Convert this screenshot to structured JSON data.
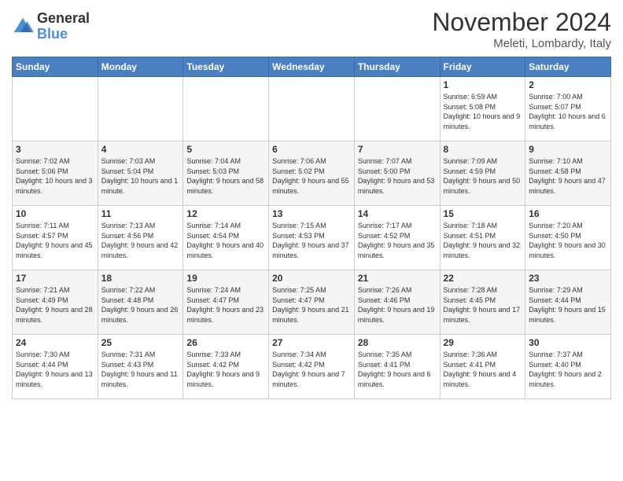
{
  "header": {
    "logo_general": "General",
    "logo_blue": "Blue",
    "month_title": "November 2024",
    "subtitle": "Meleti, Lombardy, Italy"
  },
  "days_of_week": [
    "Sunday",
    "Monday",
    "Tuesday",
    "Wednesday",
    "Thursday",
    "Friday",
    "Saturday"
  ],
  "weeks": [
    [
      {
        "day": "",
        "info": ""
      },
      {
        "day": "",
        "info": ""
      },
      {
        "day": "",
        "info": ""
      },
      {
        "day": "",
        "info": ""
      },
      {
        "day": "",
        "info": ""
      },
      {
        "day": "1",
        "info": "Sunrise: 6:59 AM\nSunset: 5:08 PM\nDaylight: 10 hours and 9 minutes."
      },
      {
        "day": "2",
        "info": "Sunrise: 7:00 AM\nSunset: 5:07 PM\nDaylight: 10 hours and 6 minutes."
      }
    ],
    [
      {
        "day": "3",
        "info": "Sunrise: 7:02 AM\nSunset: 5:06 PM\nDaylight: 10 hours and 3 minutes."
      },
      {
        "day": "4",
        "info": "Sunrise: 7:03 AM\nSunset: 5:04 PM\nDaylight: 10 hours and 1 minute."
      },
      {
        "day": "5",
        "info": "Sunrise: 7:04 AM\nSunset: 5:03 PM\nDaylight: 9 hours and 58 minutes."
      },
      {
        "day": "6",
        "info": "Sunrise: 7:06 AM\nSunset: 5:02 PM\nDaylight: 9 hours and 55 minutes."
      },
      {
        "day": "7",
        "info": "Sunrise: 7:07 AM\nSunset: 5:00 PM\nDaylight: 9 hours and 53 minutes."
      },
      {
        "day": "8",
        "info": "Sunrise: 7:09 AM\nSunset: 4:59 PM\nDaylight: 9 hours and 50 minutes."
      },
      {
        "day": "9",
        "info": "Sunrise: 7:10 AM\nSunset: 4:58 PM\nDaylight: 9 hours and 47 minutes."
      }
    ],
    [
      {
        "day": "10",
        "info": "Sunrise: 7:11 AM\nSunset: 4:57 PM\nDaylight: 9 hours and 45 minutes."
      },
      {
        "day": "11",
        "info": "Sunrise: 7:13 AM\nSunset: 4:56 PM\nDaylight: 9 hours and 42 minutes."
      },
      {
        "day": "12",
        "info": "Sunrise: 7:14 AM\nSunset: 4:54 PM\nDaylight: 9 hours and 40 minutes."
      },
      {
        "day": "13",
        "info": "Sunrise: 7:15 AM\nSunset: 4:53 PM\nDaylight: 9 hours and 37 minutes."
      },
      {
        "day": "14",
        "info": "Sunrise: 7:17 AM\nSunset: 4:52 PM\nDaylight: 9 hours and 35 minutes."
      },
      {
        "day": "15",
        "info": "Sunrise: 7:18 AM\nSunset: 4:51 PM\nDaylight: 9 hours and 32 minutes."
      },
      {
        "day": "16",
        "info": "Sunrise: 7:20 AM\nSunset: 4:50 PM\nDaylight: 9 hours and 30 minutes."
      }
    ],
    [
      {
        "day": "17",
        "info": "Sunrise: 7:21 AM\nSunset: 4:49 PM\nDaylight: 9 hours and 28 minutes."
      },
      {
        "day": "18",
        "info": "Sunrise: 7:22 AM\nSunset: 4:48 PM\nDaylight: 9 hours and 26 minutes."
      },
      {
        "day": "19",
        "info": "Sunrise: 7:24 AM\nSunset: 4:47 PM\nDaylight: 9 hours and 23 minutes."
      },
      {
        "day": "20",
        "info": "Sunrise: 7:25 AM\nSunset: 4:47 PM\nDaylight: 9 hours and 21 minutes."
      },
      {
        "day": "21",
        "info": "Sunrise: 7:26 AM\nSunset: 4:46 PM\nDaylight: 9 hours and 19 minutes."
      },
      {
        "day": "22",
        "info": "Sunrise: 7:28 AM\nSunset: 4:45 PM\nDaylight: 9 hours and 17 minutes."
      },
      {
        "day": "23",
        "info": "Sunrise: 7:29 AM\nSunset: 4:44 PM\nDaylight: 9 hours and 15 minutes."
      }
    ],
    [
      {
        "day": "24",
        "info": "Sunrise: 7:30 AM\nSunset: 4:44 PM\nDaylight: 9 hours and 13 minutes."
      },
      {
        "day": "25",
        "info": "Sunrise: 7:31 AM\nSunset: 4:43 PM\nDaylight: 9 hours and 11 minutes."
      },
      {
        "day": "26",
        "info": "Sunrise: 7:33 AM\nSunset: 4:42 PM\nDaylight: 9 hours and 9 minutes."
      },
      {
        "day": "27",
        "info": "Sunrise: 7:34 AM\nSunset: 4:42 PM\nDaylight: 9 hours and 7 minutes."
      },
      {
        "day": "28",
        "info": "Sunrise: 7:35 AM\nSunset: 4:41 PM\nDaylight: 9 hours and 6 minutes."
      },
      {
        "day": "29",
        "info": "Sunrise: 7:36 AM\nSunset: 4:41 PM\nDaylight: 9 hours and 4 minutes."
      },
      {
        "day": "30",
        "info": "Sunrise: 7:37 AM\nSunset: 4:40 PM\nDaylight: 9 hours and 2 minutes."
      }
    ]
  ]
}
